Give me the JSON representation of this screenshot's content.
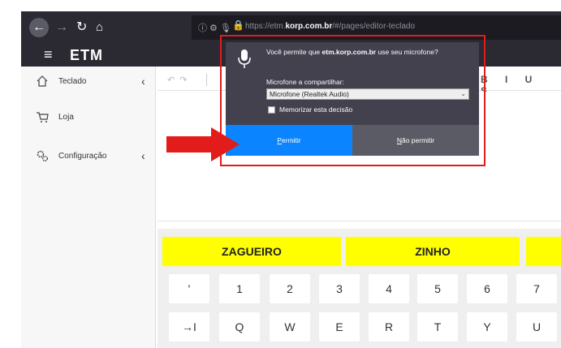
{
  "browser": {
    "url_host": "https://etm.",
    "url_domain": "korp.com.br",
    "url_path": "/#/pages/editor-teclado",
    "icons": [
      "back-icon",
      "forward-icon",
      "reload-icon",
      "home-icon",
      "info-icon",
      "permissions-icon",
      "microphone-icon",
      "lock-icon"
    ]
  },
  "app": {
    "title": "ETM"
  },
  "sidebar": {
    "items": [
      {
        "label": "Teclado",
        "icon": "house-icon",
        "has_children": true
      },
      {
        "label": "Loja",
        "icon": "cart-icon",
        "has_children": false
      },
      {
        "label": "Configuração",
        "icon": "gears-icon",
        "has_children": true
      }
    ]
  },
  "editor": {
    "toolbar_format": "B I U S"
  },
  "keyboard": {
    "suggestions": [
      "ZAGUEIRO",
      "ZINHO",
      ""
    ],
    "row1": [
      "'",
      "1",
      "2",
      "3",
      "4",
      "5",
      "6",
      "7"
    ],
    "row2": [
      "→I",
      "Q",
      "W",
      "E",
      "R",
      "T",
      "Y",
      "U"
    ]
  },
  "permission_dialog": {
    "message_prefix": "Você permite que ",
    "message_domain": "etm.korp.com.br",
    "message_suffix": " use seu microfone?",
    "share_label": "Microfone a compartilhar:",
    "selected_device": "Microfone (Realtek Audio)",
    "remember_label": "Memorizar esta decisão",
    "remember_checked": false,
    "allow_label": "Permitir",
    "deny_label": "Não permitir"
  },
  "colors": {
    "chrome_dark": "#2b2a33",
    "accent_blue": "#0a84ff",
    "suggestion_yellow": "#ffff00",
    "highlight_red": "#e21b1b"
  }
}
